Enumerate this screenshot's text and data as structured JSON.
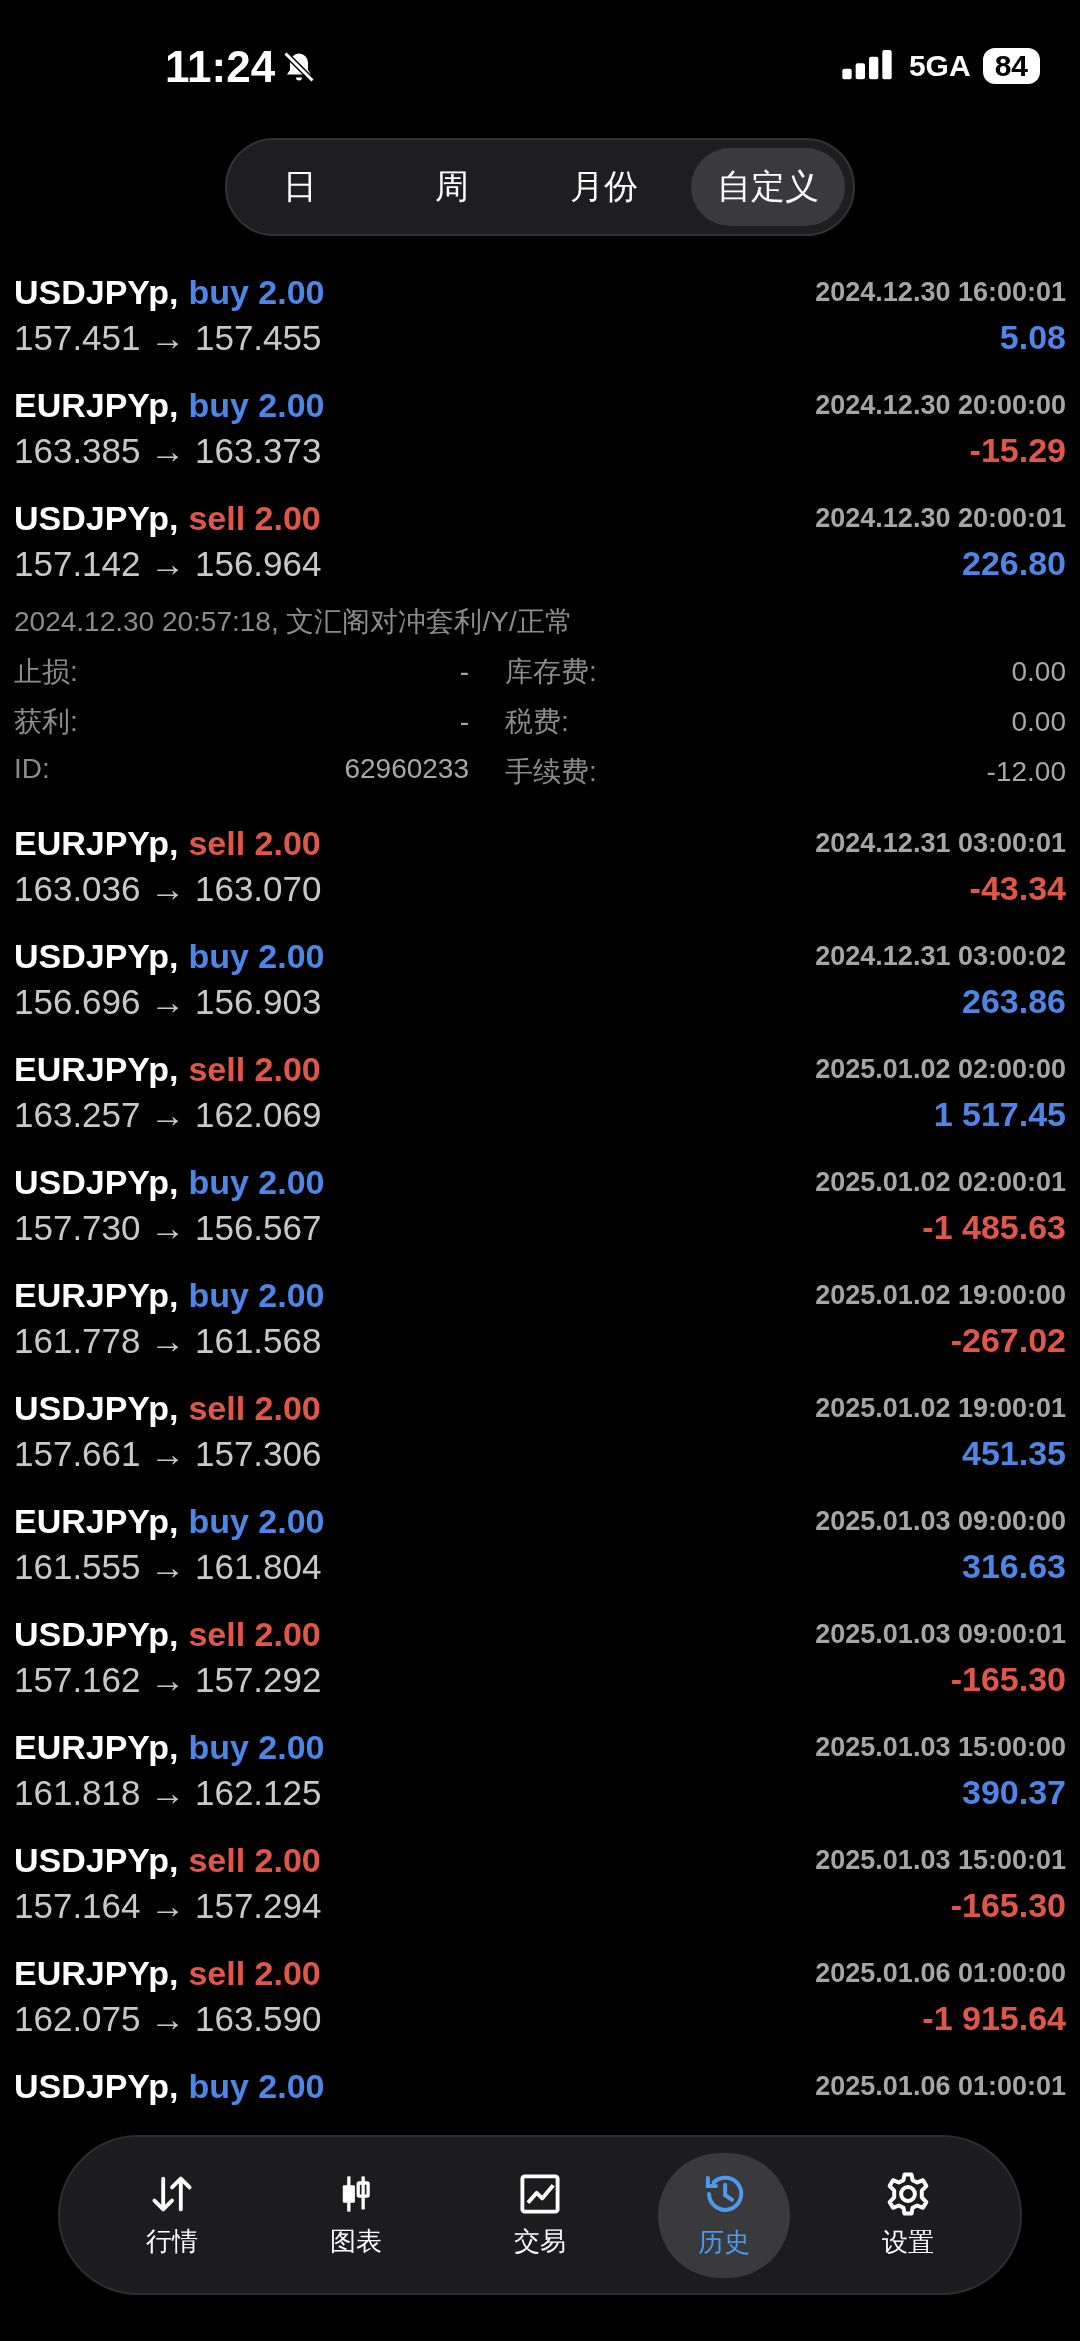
{
  "status_bar": {
    "time": "11:24",
    "network": "5GA",
    "battery": "84"
  },
  "period_tabs": [
    {
      "label": "日",
      "selected": false
    },
    {
      "label": "周",
      "selected": false
    },
    {
      "label": "月份",
      "selected": false
    },
    {
      "label": "自定义",
      "selected": true
    }
  ],
  "trades": [
    {
      "symbol": "USDJPYp,",
      "kind": "buy",
      "order": "buy 2.00",
      "time": "2024.12.30 16:00:01",
      "prices": "157.451 → 157.455",
      "profit": "5.08",
      "loss": false
    },
    {
      "symbol": "EURJPYp,",
      "kind": "buy",
      "order": "buy 2.00",
      "time": "2024.12.30 20:00:00",
      "prices": "163.385 → 163.373",
      "profit": "-15.29",
      "loss": true
    },
    {
      "symbol": "USDJPYp,",
      "kind": "sell",
      "order": "sell 2.00",
      "time": "2024.12.30 20:00:01",
      "prices": "157.142 → 156.964",
      "profit": "226.80",
      "loss": false,
      "expanded": true,
      "details": {
        "header": "2024.12.30 20:57:18, 文汇阁对冲套利/Y/正常",
        "fields": [
          {
            "label": "止损:",
            "value": "-"
          },
          {
            "label": "库存费:",
            "value": "0.00"
          },
          {
            "label": "获利:",
            "value": "-"
          },
          {
            "label": "税费:",
            "value": "0.00"
          },
          {
            "label": "ID:",
            "value": "62960233"
          },
          {
            "label": "手续费:",
            "value": "-12.00"
          }
        ]
      }
    },
    {
      "symbol": "EURJPYp,",
      "kind": "sell",
      "order": "sell 2.00",
      "time": "2024.12.31 03:00:01",
      "prices": "163.036 → 163.070",
      "profit": "-43.34",
      "loss": true
    },
    {
      "symbol": "USDJPYp,",
      "kind": "buy",
      "order": "buy 2.00",
      "time": "2024.12.31 03:00:02",
      "prices": "156.696 → 156.903",
      "profit": "263.86",
      "loss": false
    },
    {
      "symbol": "EURJPYp,",
      "kind": "sell",
      "order": "sell 2.00",
      "time": "2025.01.02 02:00:00",
      "prices": "163.257 → 162.069",
      "profit": "1 517.45",
      "loss": false
    },
    {
      "symbol": "USDJPYp,",
      "kind": "buy",
      "order": "buy 2.00",
      "time": "2025.01.02 02:00:01",
      "prices": "157.730 → 156.567",
      "profit": "-1 485.63",
      "loss": true
    },
    {
      "symbol": "EURJPYp,",
      "kind": "buy",
      "order": "buy 2.00",
      "time": "2025.01.02 19:00:00",
      "prices": "161.778 → 161.568",
      "profit": "-267.02",
      "loss": true
    },
    {
      "symbol": "USDJPYp,",
      "kind": "sell",
      "order": "sell 2.00",
      "time": "2025.01.02 19:00:01",
      "prices": "157.661 → 157.306",
      "profit": "451.35",
      "loss": false
    },
    {
      "symbol": "EURJPYp,",
      "kind": "buy",
      "order": "buy 2.00",
      "time": "2025.01.03 09:00:00",
      "prices": "161.555 → 161.804",
      "profit": "316.63",
      "loss": false
    },
    {
      "symbol": "USDJPYp,",
      "kind": "sell",
      "order": "sell 2.00",
      "time": "2025.01.03 09:00:01",
      "prices": "157.162 → 157.292",
      "profit": "-165.30",
      "loss": true
    },
    {
      "symbol": "EURJPYp,",
      "kind": "buy",
      "order": "buy 2.00",
      "time": "2025.01.03 15:00:00",
      "prices": "161.818 → 162.125",
      "profit": "390.37",
      "loss": false
    },
    {
      "symbol": "USDJPYp,",
      "kind": "sell",
      "order": "sell 2.00",
      "time": "2025.01.03 15:00:01",
      "prices": "157.164 → 157.294",
      "profit": "-165.30",
      "loss": true
    },
    {
      "symbol": "EURJPYp,",
      "kind": "sell",
      "order": "sell 2.00",
      "time": "2025.01.06 01:00:00",
      "prices": "162.075 → 163.590",
      "profit": "-1 915.64",
      "loss": true
    },
    {
      "symbol": "USDJPYp,",
      "kind": "buy",
      "order": "buy 2.00",
      "time": "2025.01.06 01:00:01"
    }
  ],
  "bottom_nav": [
    {
      "kind": "quotes",
      "label": "行情",
      "selected": false
    },
    {
      "kind": "chart",
      "label": "图表",
      "selected": false
    },
    {
      "kind": "trade",
      "label": "交易",
      "selected": false
    },
    {
      "kind": "history",
      "label": "历史",
      "selected": true
    },
    {
      "kind": "settings",
      "label": "设置",
      "selected": false
    }
  ]
}
